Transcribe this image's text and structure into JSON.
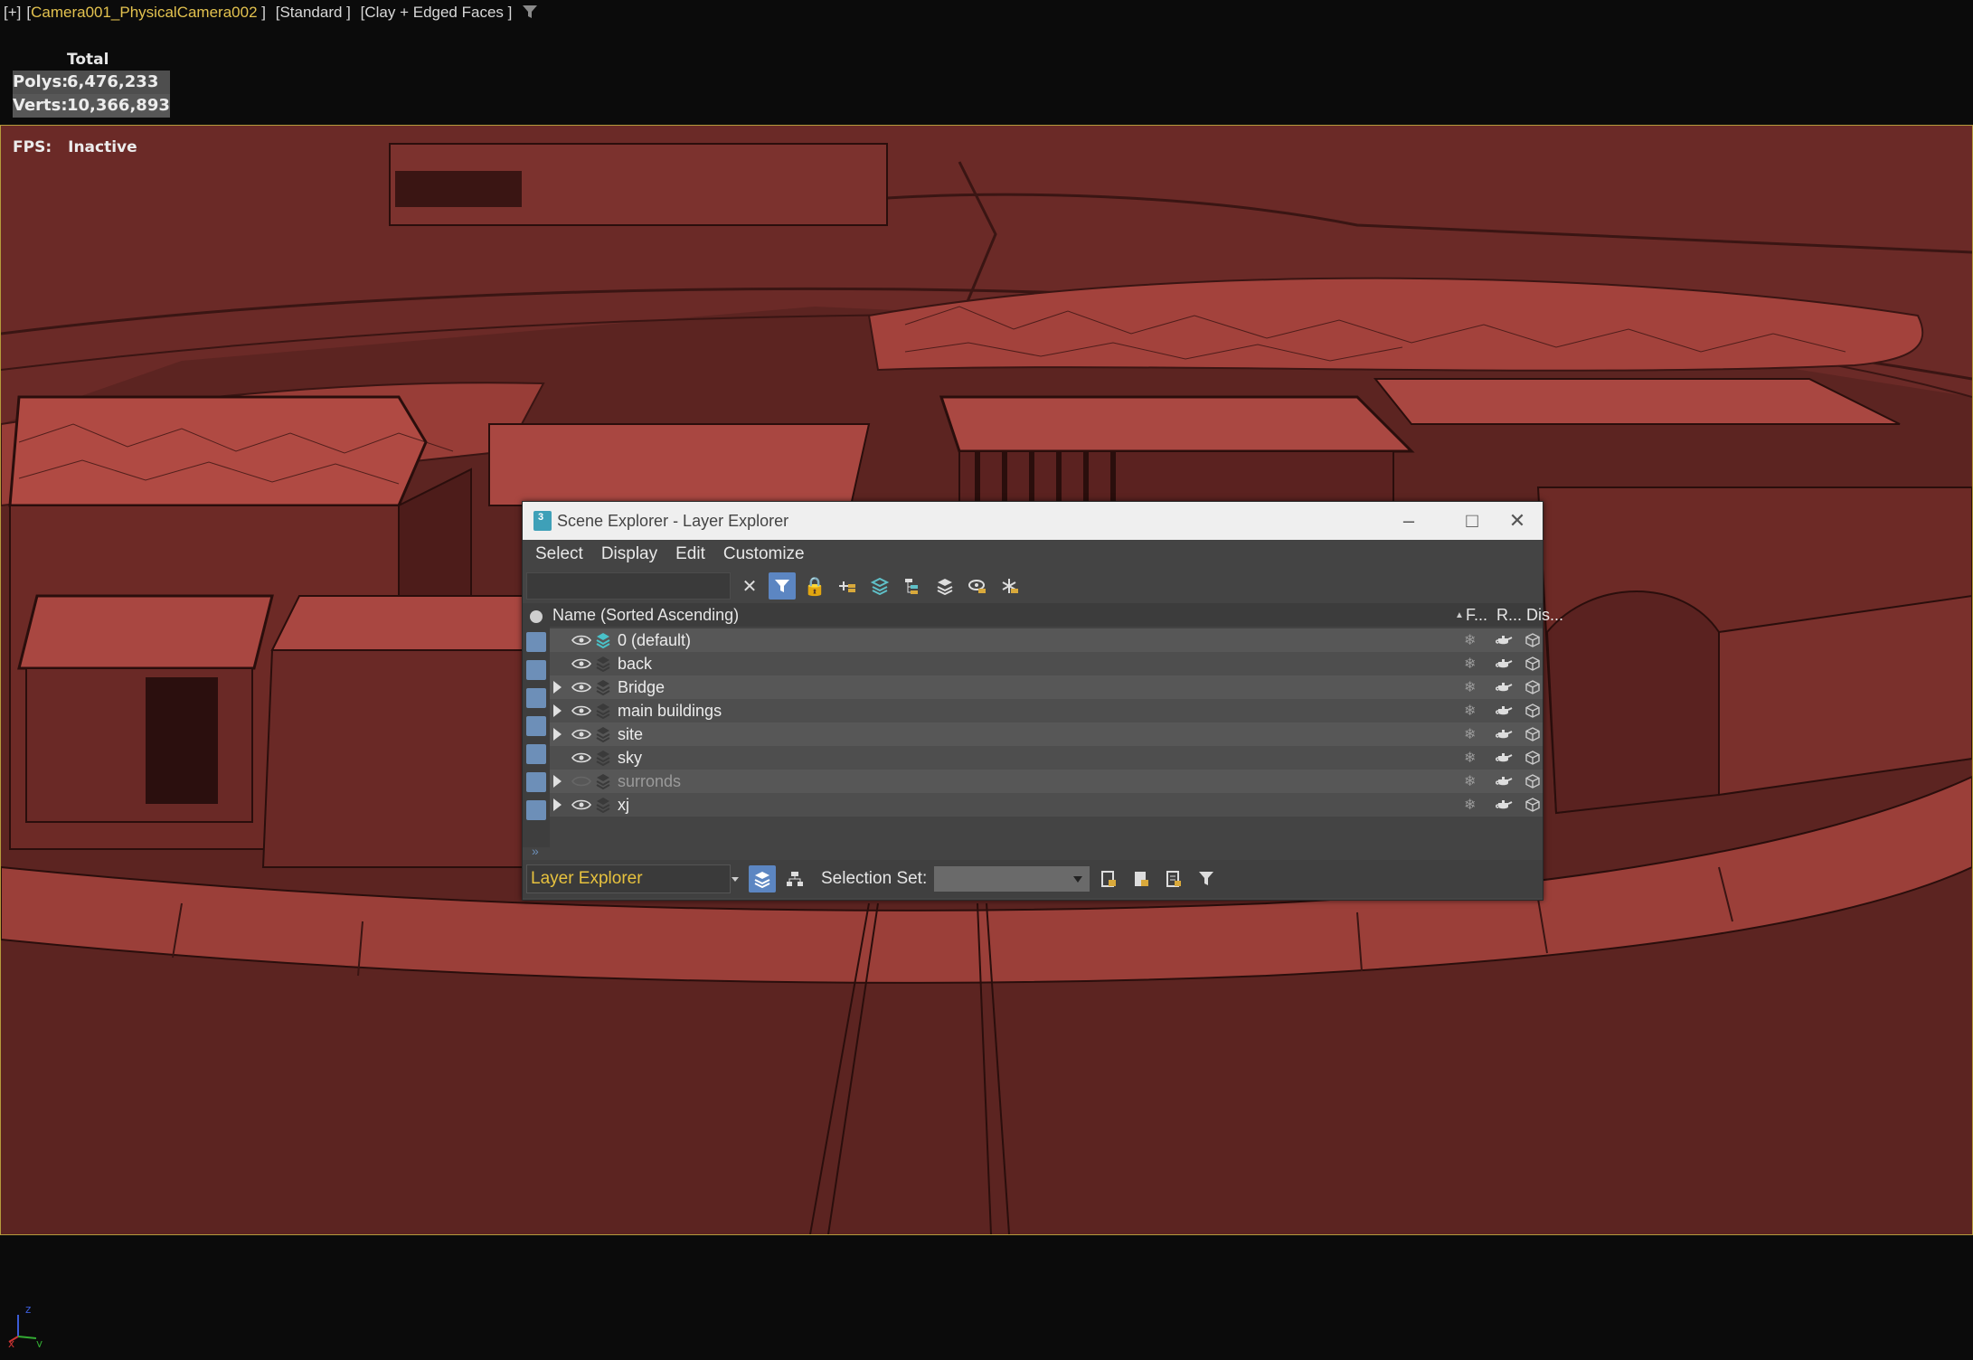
{
  "viewport_label": {
    "menu": "[+]",
    "camera": "Camera001_PhysicalCamera002",
    "shading": "[Standard ]",
    "style": "[Clay + Edged Faces ]"
  },
  "stats": {
    "header": "Total",
    "polys_label": "Polys:",
    "polys_value": "6,476,233",
    "verts_label": "Verts:",
    "verts_value": "10,366,893"
  },
  "fps": {
    "label": "FPS:",
    "value": "Inactive"
  },
  "scene_explorer": {
    "title": "Scene Explorer - Layer Explorer",
    "menu": [
      "Select",
      "Display",
      "Edit",
      "Customize"
    ],
    "search_value": "",
    "columns": {
      "name": "Name (Sorted Ascending)",
      "freeze": "F...",
      "render": "R...",
      "display": "Dis..."
    },
    "layers": [
      {
        "name": "0 (default)",
        "expandable": false,
        "active": true,
        "visible": true
      },
      {
        "name": "back",
        "expandable": false,
        "active": false,
        "visible": true
      },
      {
        "name": "Bridge",
        "expandable": true,
        "active": false,
        "visible": true
      },
      {
        "name": "main buildings",
        "expandable": true,
        "active": false,
        "visible": true
      },
      {
        "name": "site",
        "expandable": true,
        "active": false,
        "visible": true
      },
      {
        "name": "sky",
        "expandable": false,
        "active": false,
        "visible": true
      },
      {
        "name": "surronds",
        "expandable": true,
        "active": false,
        "visible": false
      },
      {
        "name": "xj",
        "expandable": true,
        "active": false,
        "visible": true
      }
    ],
    "explorer_select": "Layer Explorer",
    "selection_set_label": "Selection Set:",
    "selection_set_value": ""
  },
  "axis": {
    "x": "x",
    "y": "y",
    "z": "z"
  },
  "colors": {
    "clay": "#5e2422",
    "accent": "#5c86c2",
    "camera_text": "#e3c24f",
    "explorer_text": "#e7c23e",
    "viewport_border": "#b59b3c"
  }
}
